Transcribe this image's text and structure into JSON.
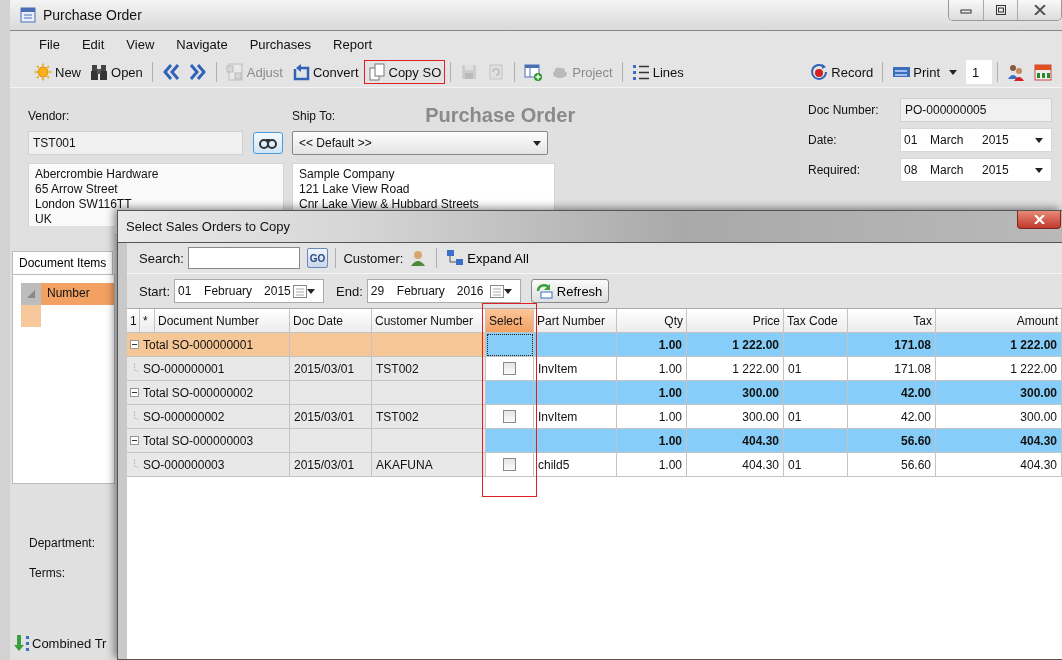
{
  "window": {
    "title": "Purchase Order"
  },
  "menu": [
    "File",
    "Edit",
    "View",
    "Navigate",
    "Purchases",
    "Report"
  ],
  "toolbar": [
    {
      "kind": "button",
      "label": "New",
      "disabled": false,
      "highlighted": false
    },
    {
      "kind": "button",
      "label": "Open",
      "disabled": false,
      "highlighted": false
    },
    {
      "kind": "separator"
    },
    {
      "kind": "icon",
      "disabled": false,
      "highlighted": false
    },
    {
      "kind": "icon",
      "disabled": false,
      "highlighted": false
    },
    {
      "kind": "separator"
    },
    {
      "kind": "button",
      "label": "Adjust",
      "disabled": true,
      "highlighted": false
    },
    {
      "kind": "button",
      "label": "Convert",
      "disabled": false,
      "highlighted": false
    },
    {
      "kind": "button",
      "label": "Copy SO",
      "disabled": false,
      "highlighted": true
    },
    {
      "kind": "separator"
    },
    {
      "kind": "icon",
      "disabled": true,
      "highlighted": false
    },
    {
      "kind": "icon",
      "disabled": true,
      "highlighted": false
    },
    {
      "kind": "separator"
    },
    {
      "kind": "icon",
      "disabled": false,
      "highlighted": false
    },
    {
      "kind": "button",
      "label": "Project",
      "disabled": true,
      "highlighted": false
    },
    {
      "kind": "separator"
    },
    {
      "kind": "button",
      "label": "Lines",
      "disabled": false,
      "highlighted": false
    },
    {
      "kind": "spacer"
    },
    {
      "kind": "button",
      "label": "Record",
      "disabled": false,
      "highlighted": false
    },
    {
      "kind": "separator"
    },
    {
      "kind": "dropdown",
      "label": "Print",
      "disabled": false,
      "highlighted": false
    },
    {
      "kind": "field",
      "value": "1"
    },
    {
      "kind": "separator"
    },
    {
      "kind": "icon",
      "disabled": false,
      "highlighted": false
    },
    {
      "kind": "icon",
      "disabled": false,
      "highlighted": false
    }
  ],
  "form": {
    "heading": "Purchase Order",
    "vendor": {
      "label": "Vendor:",
      "value": "TST001",
      "address": [
        "Abercrombie Hardware",
        "65 Arrow Street",
        "London  SW116TT",
        "UK"
      ]
    },
    "ship_to": {
      "label": "Ship To:",
      "value": "<< Default >>",
      "address": [
        "Sample Company",
        "121 Lake View Road",
        "Cnr Lake View & Hubbard Streets"
      ]
    },
    "doc_number": {
      "label": "Doc Number:",
      "value": "PO-000000005"
    },
    "date": {
      "label": "Date:",
      "day": "01",
      "month": "March",
      "year": "2015"
    },
    "required": {
      "label": "Required:",
      "day": "08",
      "month": "March",
      "year": "2015"
    }
  },
  "items_panel": {
    "tabs": [
      {
        "label": "Document Items",
        "selected": true
      }
    ],
    "column": "Number"
  },
  "footer": {
    "department": "Department:",
    "terms": "Terms:",
    "combined": "Combined Tr"
  },
  "dialog": {
    "title": "Select Sales Orders to Copy",
    "search": {
      "label": "Search:",
      "go": "GO"
    },
    "customer": "Customer:",
    "expand_all": "Expand All",
    "start": {
      "label": "Start:",
      "day": "01",
      "month": "February",
      "year": "2015"
    },
    "end": {
      "label": "End:",
      "day": "29",
      "month": "February",
      "year": "2016"
    },
    "refresh": "Refresh",
    "columns": [
      {
        "label": "1",
        "selected": false,
        "highlighted": false
      },
      {
        "label": "*",
        "selected": false,
        "highlighted": false
      },
      {
        "label": "Document Number",
        "selected": false,
        "highlighted": false
      },
      {
        "label": "Doc Date",
        "selected": false,
        "highlighted": false
      },
      {
        "label": "Customer Number",
        "selected": false,
        "highlighted": false
      },
      {
        "label": "Select",
        "selected": true,
        "highlighted": true
      },
      {
        "label": "Part Number",
        "selected": false,
        "highlighted": false
      },
      {
        "label": "Qty",
        "selected": false,
        "highlighted": false
      },
      {
        "label": "Price",
        "selected": false,
        "highlighted": false
      },
      {
        "label": "Tax Code",
        "selected": false,
        "highlighted": false
      },
      {
        "label": "Tax",
        "selected": false,
        "highlighted": false
      },
      {
        "label": "Amount",
        "selected": false,
        "highlighted": false
      }
    ],
    "rows": [
      {
        "kind": "group",
        "selected": true,
        "expanded": true,
        "document_number": "Total SO-000000001",
        "qty": "1.00",
        "price": "1 222.00",
        "tax": "171.08",
        "amount": "1 222.00"
      },
      {
        "kind": "detail",
        "selected": false,
        "document_number": "SO-000000001",
        "doc_date": "2015/03/01",
        "customer_number": "TST002",
        "checked": false,
        "part_number": "InvItem",
        "qty": "1.00",
        "price": "1 222.00",
        "tax_code": "01",
        "tax": "171.08",
        "amount": "1 222.00"
      },
      {
        "kind": "group",
        "selected": false,
        "expanded": true,
        "document_number": "Total SO-000000002",
        "qty": "1.00",
        "price": "300.00",
        "tax": "42.00",
        "amount": "300.00"
      },
      {
        "kind": "detail",
        "selected": false,
        "document_number": "SO-000000002",
        "doc_date": "2015/03/01",
        "customer_number": "TST002",
        "checked": false,
        "part_number": "InvItem",
        "qty": "1.00",
        "price": "300.00",
        "tax_code": "01",
        "tax": "42.00",
        "amount": "300.00"
      },
      {
        "kind": "group",
        "selected": false,
        "expanded": true,
        "document_number": "Total SO-000000003",
        "qty": "1.00",
        "price": "404.30",
        "tax": "56.60",
        "amount": "404.30"
      },
      {
        "kind": "detail",
        "selected": false,
        "document_number": "SO-000000003",
        "doc_date": "2015/03/01",
        "customer_number": "AKAFUNA",
        "checked": false,
        "part_number": "child5",
        "qty": "1.00",
        "price": "404.30",
        "tax_code": "01",
        "tax": "56.60",
        "amount": "404.30"
      }
    ]
  }
}
